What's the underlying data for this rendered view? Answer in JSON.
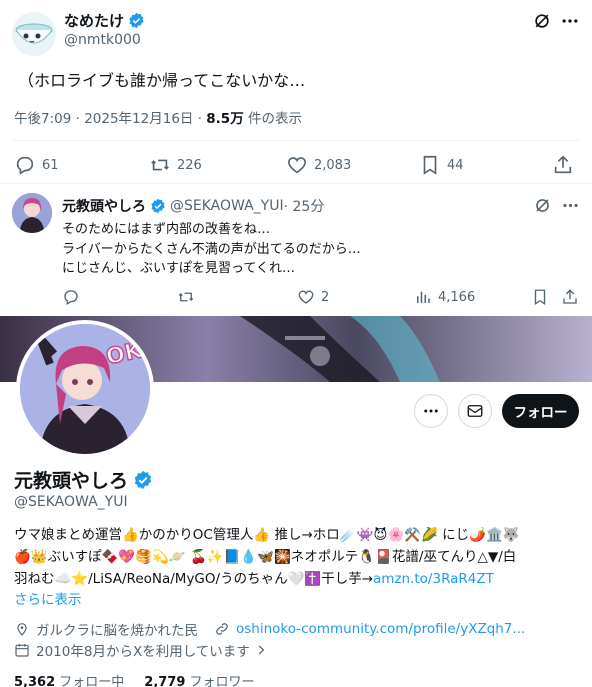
{
  "main_tweet": {
    "display_name": "なめたけ",
    "handle": "@nmtk000",
    "text": "（ホロライブも誰か帰ってこないかな…",
    "time": "午後7:09 · 2025年12月16日 · ",
    "views_count": "8.5万",
    "views_suffix": " 件の表示",
    "replies": "61",
    "retweets": "226",
    "likes": "2,083",
    "bookmarks": "44"
  },
  "reply_tweet": {
    "display_name": "元教頭やしろ",
    "handle": "@SEKAOWA_YUI",
    "time": " · 25分",
    "lines": [
      "そのためにはまず内部の改善をね…",
      "ライバーからたくさん不満の声が出てるのだから…",
      "にじさんじ、ぶいすぽを見習ってくれ…"
    ],
    "likes": "2",
    "views": "4,166"
  },
  "profile": {
    "banner_text": "OK!",
    "display_name": "元教頭やしろ",
    "handle": "@SEKAOWA_YUI",
    "follow_button": "フォロー",
    "bio_line1": "ウマ娘まとめ運営👍かのかりOC管理人👍 推し→ホロ☄️👾😈🌸⚒️🌽 にじ🌶️🏛️🐺",
    "bio_line2": "🍎👑ぶいすぽ🍫💖🥞💫🪐 🍒✨📘💧🦋🎇ネオポルテ🐧🎴花譜/巫てんり△▼/白",
    "bio_line3_pre": "羽ねむ☁️⭐/LiSA/ReoNa/MyGO/うのちゃん🤍✝️干し芋→",
    "bio_link": "amzn.to/3RaR4ZT",
    "show_more": "さらに表示",
    "location": "ガルクラに脳を焼かれた民",
    "website": "oshinoko-community.com/profile/yXZqh7...",
    "joined": "2010年8月からXを利用しています",
    "following_count": "5,362",
    "following_label": "フォロー中",
    "followers_count": "2,779",
    "followers_label": "フォロワー"
  },
  "colors": {
    "text": "#0f1419",
    "muted": "#536471",
    "accent": "#1d9bf0",
    "verified": "#1d9bf0",
    "follow_button_bg": "#0f1419"
  }
}
